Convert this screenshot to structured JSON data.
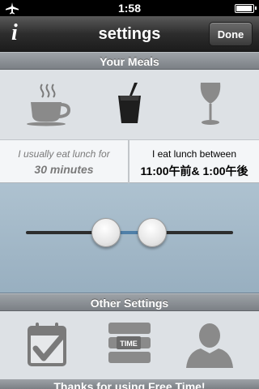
{
  "status_bar": {
    "time": "1:58",
    "icons": [
      "airplane-icon",
      "battery-icon"
    ],
    "battery_level": 0.95
  },
  "nav": {
    "info_label": "i",
    "title": "settings",
    "done_label": "Done"
  },
  "meals": {
    "header": "Your Meals",
    "icons": [
      "coffee-cup-icon",
      "drink-cup-icon",
      "wine-glass-icon"
    ],
    "lunch_duration": {
      "line1": "I usually eat lunch for",
      "line2": "30 minutes"
    },
    "lunch_between": {
      "line1": "I eat lunch between",
      "line2": "11:00午前&  1:00午後"
    }
  },
  "other": {
    "header": "Other Settings",
    "icons": [
      "calendar-check-icon",
      "time-stack-icon",
      "person-silhouette-icon"
    ],
    "time_label": "TIME"
  },
  "footer": {
    "text": "Thanks for using Free Time!"
  },
  "colors": {
    "slider_bg": "#a8bccb",
    "track": "#2d2d2d",
    "range": "#4f7fa8"
  }
}
